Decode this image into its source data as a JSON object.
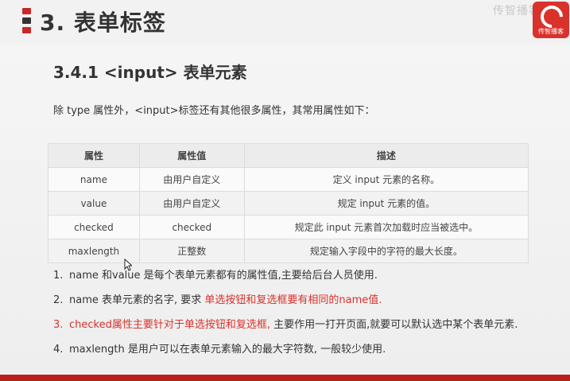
{
  "header": {
    "section_title": "3. 表单标签",
    "watermark": "传智播客"
  },
  "logo": {
    "text": "传智播客"
  },
  "sub_title": "3.4.1 <input> 表单元素",
  "intro": "除 type 属性外，<input>标签还有其他很多属性，其常用属性如下：",
  "table": {
    "headers": [
      "属性",
      "属性值",
      "描述"
    ],
    "rows": [
      [
        "name",
        "由用户自定义",
        "定义 input 元素的名称。"
      ],
      [
        "value",
        "由用户自定义",
        "规定 input 元素的值。"
      ],
      [
        "checked",
        "checked",
        "规定此 input 元素首次加载时应当被选中。"
      ],
      [
        "maxlength",
        "正整数",
        "规定输入字段中的字符的最大长度。"
      ]
    ]
  },
  "notes": [
    {
      "num": "1.",
      "text": "name 和value 是每个表单元素都有的属性值,主要给后台人员使用."
    },
    {
      "num": "2.",
      "prefix": "name 表单元素的名字, 要求 ",
      "red": "单选按钮和复选框要有相同的name值."
    },
    {
      "num": "3.",
      "red": "checked属性主要针对于单选按钮和复选框,",
      "suffix": " 主要作用一打开页面,就要可以默认选中某个表单元素."
    },
    {
      "num": "4.",
      "text": "maxlength 是用户可以在表单元素输入的最大字符数, 一般较少使用."
    }
  ],
  "colors": {
    "accent": "#d9322b",
    "text": "#333333"
  }
}
